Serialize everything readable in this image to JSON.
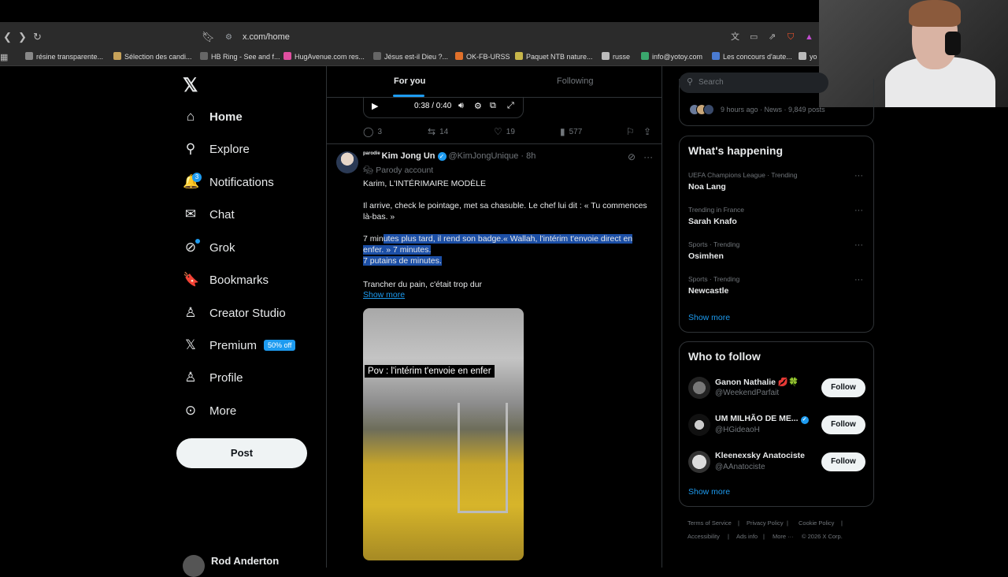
{
  "browser": {
    "url": "x.com/home",
    "bookmarks": [
      {
        "label": "résine transparente...",
        "color": "#888"
      },
      {
        "label": "Sélection des candi...",
        "color": "#c7a25a"
      },
      {
        "label": "HB Ring - See and f...",
        "color": "#666"
      },
      {
        "label": "HugAvenue.com res...",
        "color": "#e04fa0"
      },
      {
        "label": "Jésus est-il Dieu ?...",
        "color": "#666"
      },
      {
        "label": "OK-FB-URSS",
        "color": "#e0702a"
      },
      {
        "label": "Paquet NTB nature...",
        "color": "#c7b64a"
      },
      {
        "label": "russe",
        "color": "#bbb"
      },
      {
        "label": "info@yotoy.com",
        "color": "#3aa76d"
      },
      {
        "label": "Les concours d'aute...",
        "color": "#4a7bd1"
      },
      {
        "label": "yo",
        "color": "#bbb"
      }
    ]
  },
  "nav": {
    "items": [
      {
        "label": "Home",
        "icon": "home-icon",
        "glyph": "⌂"
      },
      {
        "label": "Explore",
        "icon": "search-icon",
        "glyph": "⚲"
      },
      {
        "label": "Notifications",
        "icon": "bell-icon",
        "glyph": "🔔"
      },
      {
        "label": "Chat",
        "icon": "mail-icon",
        "glyph": "✉"
      },
      {
        "label": "Grok",
        "icon": "grok-icon",
        "glyph": "⊘"
      },
      {
        "label": "Bookmarks",
        "icon": "bookmark-icon",
        "glyph": "🔖"
      },
      {
        "label": "Creator Studio",
        "icon": "creator-studio-icon",
        "glyph": "♙"
      },
      {
        "label": "Premium",
        "icon": "x-premium-icon",
        "glyph": "𝕏"
      },
      {
        "label": "Profile",
        "icon": "person-icon",
        "glyph": "♙"
      },
      {
        "label": "More",
        "icon": "more-circle-icon",
        "glyph": "⊙"
      }
    ],
    "notifications_count": "3",
    "premium_badge": "50% off",
    "post_label": "Post",
    "account_name": "Rod Anderton"
  },
  "feed": {
    "tab_for_you": "For you",
    "tab_following": "Following",
    "player_time": "0:38 / 0:40",
    "prev_actions": {
      "replies": "3",
      "reposts": "14",
      "likes": "19",
      "views": "577"
    },
    "tweet": {
      "parody_mark": "parodie",
      "name": "Kim Jong Un",
      "handle": "@KimJongUnique",
      "time": "· 8h",
      "parody_label": "Parody account",
      "line1": "Karim, L'INTÉRIMAIRE MODÈLE",
      "para2": "Il arrive, check le pointage, met sa chasuble. Le chef lui dit : « Tu commences là-bas. »",
      "para3_a": "7 min",
      "para3_b": "utes plus tard, il rend son badge.« Wallah, l'intérim t'envoie direct en enfer. » 7 minutes.",
      "para3_c": "7 putains de minutes.",
      "para4": "Trancher du pain, c'était trop dur",
      "show_more": "Show more",
      "video_caption": "Pov : l'intérim t'envoie en enfer"
    }
  },
  "sidebar": {
    "search_placeholder": "Search",
    "top_trend_meta": "9 hours ago · News · 9,849 posts",
    "happening_title": "What's happening",
    "trends": [
      {
        "context": "UEFA Champions League · Trending",
        "name": "Noa Lang"
      },
      {
        "context": "Trending in France",
        "name": "Sarah Knafo"
      },
      {
        "context": "Sports · Trending",
        "name": "Osimhen"
      },
      {
        "context": "Sports · Trending",
        "name": "Newcastle"
      }
    ],
    "show_more": "Show more",
    "wtf_title": "Who to follow",
    "follow": [
      {
        "name": "Ganon Nathalie 💋🍀",
        "handle": "@WeekendParfait",
        "verified": false
      },
      {
        "name": "UM MILHÃO DE ME...",
        "handle": "@HGideaoH",
        "verified": true
      },
      {
        "name": "Kleenexsky Anatociste",
        "handle": "@AAnatociste",
        "verified": false
      }
    ],
    "follow_label": "Follow",
    "wtf_show_more": "Show more",
    "footer": [
      "Terms of Service",
      "|",
      "Privacy Policy",
      "|",
      "Cookie Policy",
      "|",
      "Accessibility",
      "|",
      "Ads info",
      "|",
      "More ···",
      "© 2026 X Corp."
    ]
  }
}
